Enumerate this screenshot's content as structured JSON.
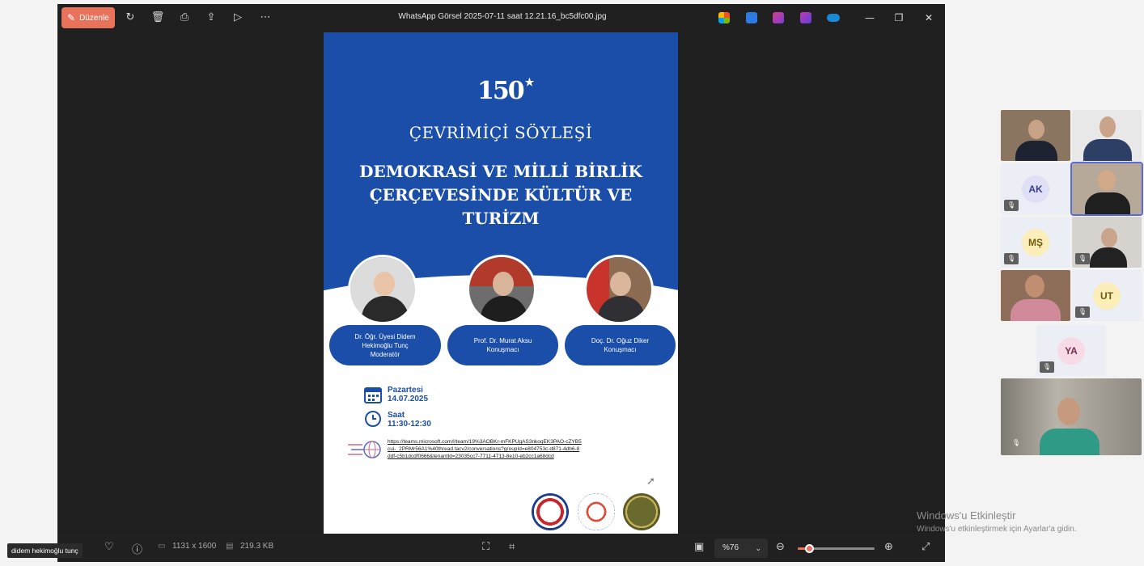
{
  "viewer": {
    "edit_label": "Düzenle",
    "file_title": "WhatsApp Görsel 2025-07-11 saat 12.21.16_bc5dfc00.jpg",
    "dimensions": "1131 x 1600",
    "file_size": "219.3 KB",
    "zoom_label": "%76",
    "zoom_level_fraction": 0.15
  },
  "poster": {
    "logo_text": "150",
    "subtitle": "ÇEVRİMİÇİ SÖYLEŞİ",
    "title_line1": "DEMOKRASİ VE MİLLİ BİRLİK",
    "title_line2": "ÇERÇEVESİNDE KÜLTÜR VE",
    "title_line3": "TURİZM",
    "speakers": [
      {
        "line1": "Dr. Öğr. Üyesi Didem",
        "line2": "Hekimoğlu Tunç",
        "line3": "Moderatör"
      },
      {
        "line1": "Prof. Dr. Murat Aksu",
        "line2": "Konuşmacı",
        "line3": ""
      },
      {
        "line1": "Doç. Dr. Oğuz Diker",
        "line2": "Konuşmacı",
        "line3": ""
      }
    ],
    "day_label": "Pazartesi",
    "date": "14.07.2025",
    "time_label": "Saat",
    "time": "11:30-12:30",
    "link": "https://teams.microsoft.com/l/team/19%3AOBKr-mFKPUgAS3nkoqEK3PAO-cZYB5cui-_2PRMr56A1%40thread.tacv2/conversations?groupId=e804753c-d871-4db6-8ddf-c5b1dcdf0666&tenantId=23035cc7-7711-4713-8e10-eb2cc1a68dcd"
  },
  "presenter_name": "didem hekimoğlu tunç",
  "participants": [
    {
      "initials": "AK"
    },
    {
      "initials": "MŞ"
    },
    {
      "initials": "UT"
    },
    {
      "initials": "YA"
    }
  ],
  "watermark": {
    "line1": "Windows'u Etkinleştir",
    "line2": "Windows'u etkinleştirmek için Ayarlar'a gidin."
  },
  "colors": {
    "accent": "#e8735a",
    "poster_blue": "#1b4ea8",
    "active_tile": "#5b6bd6"
  }
}
